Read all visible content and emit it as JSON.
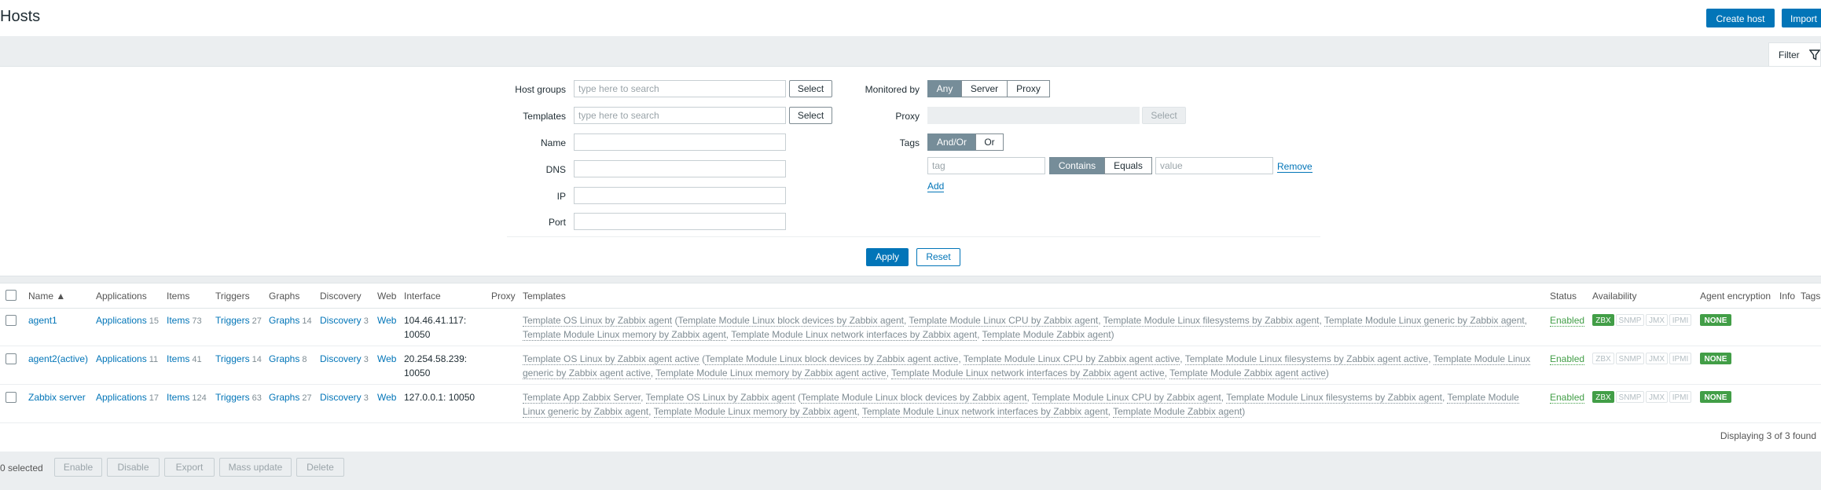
{
  "page": {
    "title": "Hosts",
    "create_host": "Create host",
    "import": "Import"
  },
  "filter": {
    "tab_label": "Filter",
    "host_groups_label": "Host groups",
    "host_groups_placeholder": "type here to search",
    "templates_label": "Templates",
    "templates_placeholder": "type here to search",
    "select_label": "Select",
    "name_label": "Name",
    "dns_label": "DNS",
    "ip_label": "IP",
    "port_label": "Port",
    "monitored_by_label": "Monitored by",
    "monitored_by_options": [
      "Any",
      "Server",
      "Proxy"
    ],
    "monitored_by_selected": "Any",
    "proxy_label": "Proxy",
    "tags_label": "Tags",
    "tags_operator_options": [
      "And/Or",
      "Or"
    ],
    "tags_operator_selected": "And/Or",
    "tag_placeholder": "tag",
    "tag_match_options": [
      "Contains",
      "Equals"
    ],
    "tag_match_selected": "Contains",
    "value_placeholder": "value",
    "remove_label": "Remove",
    "add_label": "Add",
    "apply_label": "Apply",
    "reset_label": "Reset"
  },
  "table": {
    "headers": {
      "name": "Name ▲",
      "applications": "Applications",
      "items": "Items",
      "triggers": "Triggers",
      "graphs": "Graphs",
      "discovery": "Discovery",
      "web": "Web",
      "interface": "Interface",
      "proxy": "Proxy",
      "templates": "Templates",
      "status": "Status",
      "availability": "Availability",
      "agent_encryption": "Agent encryption",
      "info": "Info",
      "tags": "Tags"
    },
    "rows": [
      {
        "name": "agent1",
        "applications": "Applications",
        "applications_count": "15",
        "items": "Items",
        "items_count": "73",
        "triggers": "Triggers",
        "triggers_count": "27",
        "graphs": "Graphs",
        "graphs_count": "14",
        "discovery": "Discovery",
        "discovery_count": "3",
        "web": "Web",
        "interface_line1": "104.46.41.117:",
        "interface_line2": "10050",
        "templates": [
          {
            "text": "Template OS Linux by Zabbix agent",
            "link": true
          },
          {
            "text": " (",
            "link": false
          },
          {
            "text": "Template Module Linux block devices by Zabbix agent",
            "link": true
          },
          {
            "text": ", ",
            "link": false
          },
          {
            "text": "Template Module Linux CPU by Zabbix agent",
            "link": true
          },
          {
            "text": ", ",
            "link": false
          },
          {
            "text": "Template Module Linux filesystems by Zabbix agent",
            "link": true
          },
          {
            "text": ", ",
            "link": false
          },
          {
            "text": "Template Module Linux generic by Zabbix agent",
            "link": true
          },
          {
            "text": ", ",
            "link": false
          },
          {
            "text": "Template Module Linux memory by Zabbix agent",
            "link": true
          },
          {
            "text": ", ",
            "link": false
          },
          {
            "text": "Template Module Linux network interfaces by Zabbix agent",
            "link": true
          },
          {
            "text": ", ",
            "link": false
          },
          {
            "text": "Template Module Zabbix agent",
            "link": true
          },
          {
            "text": ")",
            "link": false
          }
        ],
        "status": "Enabled",
        "zbx_active": true,
        "encryption": "NONE"
      },
      {
        "name": "agent2(active)",
        "applications": "Applications",
        "applications_count": "11",
        "items": "Items",
        "items_count": "41",
        "triggers": "Triggers",
        "triggers_count": "14",
        "graphs": "Graphs",
        "graphs_count": "8",
        "discovery": "Discovery",
        "discovery_count": "3",
        "web": "Web",
        "interface_line1": "20.254.58.239:",
        "interface_line2": "10050",
        "templates": [
          {
            "text": "Template OS Linux by Zabbix agent active",
            "link": true
          },
          {
            "text": " (",
            "link": false
          },
          {
            "text": "Template Module Linux block devices by Zabbix agent active",
            "link": true
          },
          {
            "text": ", ",
            "link": false
          },
          {
            "text": "Template Module Linux CPU by Zabbix agent active",
            "link": true
          },
          {
            "text": ", ",
            "link": false
          },
          {
            "text": "Template Module Linux filesystems by Zabbix agent active",
            "link": true
          },
          {
            "text": ", ",
            "link": false
          },
          {
            "text": "Template Module Linux generic by Zabbix agent active",
            "link": true
          },
          {
            "text": ", ",
            "link": false
          },
          {
            "text": "Template Module Linux memory by Zabbix agent active",
            "link": true
          },
          {
            "text": ", ",
            "link": false
          },
          {
            "text": "Template Module Linux network interfaces by Zabbix agent active",
            "link": true
          },
          {
            "text": ", ",
            "link": false
          },
          {
            "text": "Template Module Zabbix agent active",
            "link": true
          },
          {
            "text": ")",
            "link": false
          }
        ],
        "status": "Enabled",
        "zbx_active": false,
        "encryption": "NONE"
      },
      {
        "name": "Zabbix server",
        "applications": "Applications",
        "applications_count": "17",
        "items": "Items",
        "items_count": "124",
        "triggers": "Triggers",
        "triggers_count": "63",
        "graphs": "Graphs",
        "graphs_count": "27",
        "discovery": "Discovery",
        "discovery_count": "3",
        "web": "Web",
        "interface_line1": "127.0.0.1: 10050",
        "interface_line2": "",
        "templates": [
          {
            "text": "Template App Zabbix Server",
            "link": true
          },
          {
            "text": ", ",
            "link": false
          },
          {
            "text": "Template OS Linux by Zabbix agent",
            "link": true
          },
          {
            "text": " (",
            "link": false
          },
          {
            "text": "Template Module Linux block devices by Zabbix agent",
            "link": true
          },
          {
            "text": ", ",
            "link": false
          },
          {
            "text": "Template Module Linux CPU by Zabbix agent",
            "link": true
          },
          {
            "text": ", ",
            "link": false
          },
          {
            "text": "Template Module Linux filesystems by Zabbix agent",
            "link": true
          },
          {
            "text": ", ",
            "link": false
          },
          {
            "text": "Template Module Linux generic by Zabbix agent",
            "link": true
          },
          {
            "text": ", ",
            "link": false
          },
          {
            "text": "Template Module Linux memory by Zabbix agent",
            "link": true
          },
          {
            "text": ", ",
            "link": false
          },
          {
            "text": "Template Module Linux network interfaces by Zabbix agent",
            "link": true
          },
          {
            "text": ", ",
            "link": false
          },
          {
            "text": "Template Module Zabbix agent",
            "link": true
          },
          {
            "text": ")",
            "link": false
          }
        ],
        "status": "Enabled",
        "zbx_active": true,
        "encryption": "NONE"
      }
    ],
    "availability_labels": [
      "ZBX",
      "SNMP",
      "JMX",
      "IPMI"
    ],
    "displaying": "Displaying 3 of 3 found"
  },
  "footer": {
    "selected": "0 selected",
    "buttons": [
      "Enable",
      "Disable",
      "Export",
      "Mass update",
      "Delete"
    ]
  },
  "colors": {
    "accent": "#0275b8",
    "enabled": "#429e47",
    "background": "#ebeef0"
  }
}
